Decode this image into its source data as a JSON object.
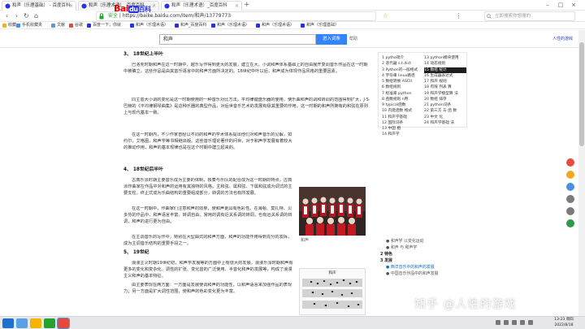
{
  "browser": {
    "tabs": [
      {
        "label": "和声（乐理基础） - 百度百科"
      },
      {
        "label": "和声（乐理术语）_百度百科"
      },
      {
        "label": "和声（乐理术语）_百度百科"
      }
    ],
    "new_tab": "+",
    "url_secure": "安全",
    "url": "https://baike.baidu.com/item/和声/13779773",
    "search_placeholder": "立即搜索你想搜的"
  },
  "bookmarks": [
    {
      "label": "收藏",
      "color": "#f5b400"
    },
    {
      "label": "手机收藏夹",
      "color": "#4a90e2"
    },
    {
      "label": "文献",
      "color": "#5b9bd5"
    },
    {
      "label": "谷歌",
      "color": "#e24a3b"
    },
    {
      "label": "百度一下，你就",
      "color": "#2932e1"
    },
    {
      "label": "和声（乐理术语）",
      "color": "#2932e1"
    },
    {
      "label": "和声_百度百科",
      "color": "#2932e1"
    },
    {
      "label": "和声（乐理术语）",
      "color": "#2932e1"
    },
    {
      "label": "和声（乐理术语）",
      "color": "#2932e1"
    },
    {
      "label": "和声（乐理基础）",
      "color": "#2932e1"
    }
  ],
  "baike": {
    "logo_text": "Bai",
    "logo_du": "du",
    "logo_suffix": "百科",
    "query": "和声",
    "enter_label": "进入词条",
    "help_label": "帮助",
    "user_link": "人性的游戏"
  },
  "article": {
    "section3_title": "3、 18世纪上半叶",
    "p1": "巴洛克时期和声在这一时期中，越乐写作得到更大的发展，建立在大、小调和声体系基础上的自由展开复调音乐作品在这一时期中被确立，这些作品是由其音乐语言中的和声方面所决定的。18世纪中叶以后，和声成为体现作品风格的重要因素。",
    "p2": "同主音大小调的变化是这一时期使用的一种音乐对比方法。平均律键盘乐器的使用，使乐曲和声的调和转调的范围得到扩大，J·S·巴赫的《平均律钢琴曲集》是这种乐器的典型作品，对后世音乐艺术的发展有极其重要的作用。这一时期的和声所拥有的和弦在原则上与现代基本一致。",
    "p3": "在这一时期内，不少作家曾经以不同的和声的学术体系提出他们对和声音乐的见解，如约尔，艾格图，和声学等书相继出版。这些音乐理论著作的问世，对于和声学发展有着较大的推动作用，和声的基本规律也是在这个时期中建立起来的。",
    "section4_title": "4、 18世纪后半叶",
    "p4": "古典乐派时期主要音乐成为主要的体制，独奏与乐队的配合成为这一时期的特点。古典派作曲家在作品中对和声的运用有其独特的风格。主和弦、属和弦、下属和弦成为调式的主要支柱，终止式成为乐曲结构的重要组成部分，转调的方法也有所发展。",
    "p5": "在这一时期中，作曲家们注意和声的效果，使和声更具有色彩性。在海顿、莫扎特、贝多芬的作品中，和声语言丰富，转调自由，常用的调有近关系调的转调，也有远关系调的转调，和声的进行更为自由。",
    "p6": "在主调音乐的写作中，特别在大型曲式的和声方面，和声的功能作用得到充分的发挥，成为主调音乐结构的重要手段之一。",
    "section5_title": "5、 19世纪",
    "p7": "浪漫主义时期19世纪初，和声学发展等的方面中上有很大的发展，浪漫乐派时期和声有更多的变化和复杂化，调性的扩张、变化音的广泛使用、半音化和声的发展等，构成了浪漫主义和声的基本特征。",
    "p8": "由主要表现在两方面：一方面是发展使调和声的功能性，以和声语言来加强作品的表现力；另一方面是扩大调性范围，使和声的色彩变化更为丰富。"
  },
  "figures": {
    "img1_caption": "和声",
    "img2_title": "和声"
  },
  "toc": {
    "left": [
      "1 pytho简介",
      "2 迭代器 s.t.dict",
      "3 Python的一般格式",
      "4 字符串 linux路径",
      "5 数组转换 ASCII",
      "6 数组规则",
      "7 标准库 python",
      "8 函数规则 n用",
      "9 typical函数",
      "10 内建函数 格式",
      "11 和声学基础",
      "12 国际词条",
      "13 中国 相",
      "14 和声学"
    ],
    "right": [
      "13 python模块使用",
      "14 动态规划",
      "15 数组 统计",
      "16 生成器表达式",
      "17 和声 规则",
      "18 有限 列表 算",
      "19 和声学模型算 法",
      "20 数组 排序",
      "21 python词条",
      "22 第三方 与 函 数",
      "23 中文 化",
      "24 和声学基础 法"
    ],
    "highlight": "15 数组 统计"
  },
  "sidenav": {
    "items": [
      {
        "label": "● 和声学 以变化运动",
        "kind": "sub"
      },
      {
        "label": "● 和声 与 和声学",
        "kind": "sub"
      },
      {
        "label": "2 特色",
        "kind": "head"
      },
      {
        "label": "3 发展",
        "kind": "head"
      },
      {
        "label": "● 西洋音乐中的和声的发展",
        "kind": "sel"
      },
      {
        "label": "● 中国音乐作品中的和声发展",
        "kind": "sub"
      }
    ]
  },
  "watermark": "知乎 @人性的游戏",
  "taskbar": {
    "time": "13:23 周四",
    "date": "2022/8/18"
  },
  "colors": {
    "baidu_blue": "#3385ff",
    "baidu_red": "#e10602",
    "link": "#136ec2"
  }
}
